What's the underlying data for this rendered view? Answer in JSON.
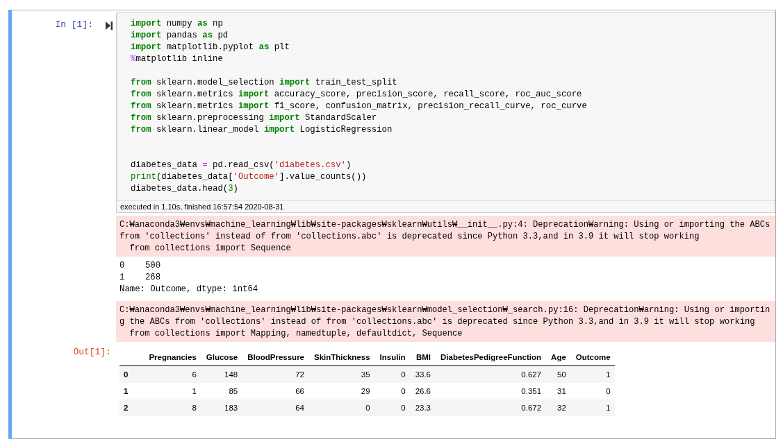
{
  "cell": {
    "selected": true,
    "prompt_in": "In [1]:",
    "code": [
      {
        "kind": "code",
        "tokens": [
          {
            "kind": "kw",
            "text": "import"
          },
          {
            "kind": "plain",
            "text": " numpy "
          },
          {
            "kind": "kw",
            "text": "as"
          },
          {
            "kind": "plain",
            "text": " np"
          }
        ]
      },
      {
        "kind": "code",
        "tokens": [
          {
            "kind": "kw",
            "text": "import"
          },
          {
            "kind": "plain",
            "text": " pandas "
          },
          {
            "kind": "kw",
            "text": "as"
          },
          {
            "kind": "plain",
            "text": " pd"
          }
        ]
      },
      {
        "kind": "code",
        "tokens": [
          {
            "kind": "kw",
            "text": "import"
          },
          {
            "kind": "plain",
            "text": " matplotlib.pyplot "
          },
          {
            "kind": "kw",
            "text": "as"
          },
          {
            "kind": "plain",
            "text": " plt"
          }
        ]
      },
      {
        "kind": "code",
        "tokens": [
          {
            "kind": "magic",
            "text": "%"
          },
          {
            "kind": "plain",
            "text": "matplotlib inline"
          }
        ]
      },
      {
        "kind": "blank"
      },
      {
        "kind": "code",
        "tokens": [
          {
            "kind": "kw",
            "text": "from"
          },
          {
            "kind": "plain",
            "text": " sklearn.model_selection "
          },
          {
            "kind": "kw",
            "text": "import"
          },
          {
            "kind": "plain",
            "text": " train_test_split"
          }
        ]
      },
      {
        "kind": "code",
        "tokens": [
          {
            "kind": "kw",
            "text": "from"
          },
          {
            "kind": "plain",
            "text": " sklearn.metrics "
          },
          {
            "kind": "kw",
            "text": "import"
          },
          {
            "kind": "plain",
            "text": " accuracy_score, precision_score, recall_score, roc_auc_score"
          }
        ]
      },
      {
        "kind": "code",
        "tokens": [
          {
            "kind": "kw",
            "text": "from"
          },
          {
            "kind": "plain",
            "text": " sklearn.metrics "
          },
          {
            "kind": "kw",
            "text": "import"
          },
          {
            "kind": "plain",
            "text": " f1_score, confusion_matrix, precision_recall_curve, roc_curve"
          }
        ]
      },
      {
        "kind": "code",
        "tokens": [
          {
            "kind": "kw",
            "text": "from"
          },
          {
            "kind": "plain",
            "text": " sklearn.preprocessing "
          },
          {
            "kind": "kw",
            "text": "import"
          },
          {
            "kind": "plain",
            "text": " StandardScaler"
          }
        ]
      },
      {
        "kind": "code",
        "tokens": [
          {
            "kind": "kw",
            "text": "from"
          },
          {
            "kind": "plain",
            "text": " sklearn.linear_model "
          },
          {
            "kind": "kw",
            "text": "import"
          },
          {
            "kind": "plain",
            "text": " LogisticRegression"
          }
        ]
      },
      {
        "kind": "blank"
      },
      {
        "kind": "blank"
      },
      {
        "kind": "code",
        "tokens": [
          {
            "kind": "plain",
            "text": "diabetes_data "
          },
          {
            "kind": "op",
            "text": "="
          },
          {
            "kind": "plain",
            "text": " pd.read_csv("
          },
          {
            "kind": "str",
            "text": "'diabetes.csv'"
          },
          {
            "kind": "plain",
            "text": ")"
          }
        ]
      },
      {
        "kind": "code",
        "tokens": [
          {
            "kind": "builtin",
            "text": "print"
          },
          {
            "kind": "plain",
            "text": "(diabetes_data["
          },
          {
            "kind": "str",
            "text": "'Outcome'"
          },
          {
            "kind": "plain",
            "text": "].value_counts())"
          }
        ]
      },
      {
        "kind": "code",
        "tokens": [
          {
            "kind": "plain",
            "text": "diabetes_data.head("
          },
          {
            "kind": "num",
            "text": "3"
          },
          {
            "kind": "plain",
            "text": ")"
          }
        ]
      }
    ],
    "execution_info": "executed in 1.10s, finished 16:57:54 2020-08-31",
    "outputs": [
      {
        "kind": "stderr",
        "text": "C:₩anaconda3₩envs₩machine_learning₩lib₩site-packages₩sklearn₩utils₩__init__.py:4: Deprecation₩arning: Using or importing the ABCs from 'collections' instead of from 'collections.abc' is deprecated since Python 3.3,and in 3.9 it will stop working\n  from collections import Sequence"
      },
      {
        "kind": "stdout",
        "text": "0    500\n1    268\nName: Outcome, dtype: int64"
      },
      {
        "kind": "stderr",
        "text": "C:₩anaconda3₩envs₩machine_learning₩lib₩site-packages₩sklearn₩model_selection₩_search.py:16: Deprecation₩arning: Using or importing the ABCs from 'collections' instead of from 'collections.abc' is deprecated since Python 3.3,and in 3.9 it will stop working\n  from collections import Mapping, namedtuple, defaultdict, Sequence"
      },
      {
        "kind": "table",
        "prompt": "Out[1]:",
        "columns": [
          "Pregnancies",
          "Glucose",
          "BloodPressure",
          "SkinThickness",
          "Insulin",
          "BMI",
          "DiabetesPedigreeFunction",
          "Age",
          "Outcome"
        ],
        "rows": [
          {
            "index": "0",
            "cells": [
              "6",
              "148",
              "72",
              "35",
              "0",
              "33.6",
              "0.627",
              "50",
              "1"
            ]
          },
          {
            "index": "1",
            "cells": [
              "1",
              "85",
              "66",
              "29",
              "0",
              "26.6",
              "0.351",
              "31",
              "0"
            ]
          },
          {
            "index": "2",
            "cells": [
              "8",
              "183",
              "64",
              "0",
              "0",
              "23.3",
              "0.672",
              "32",
              "1"
            ]
          }
        ]
      }
    ]
  }
}
